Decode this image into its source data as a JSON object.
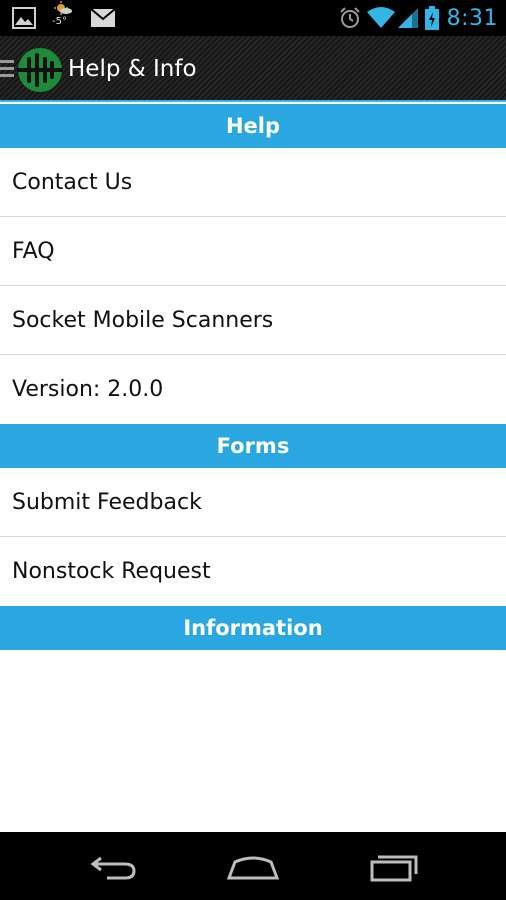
{
  "status_bar": {
    "weather_temp": "-5°",
    "time": "8:31",
    "icons": [
      "image-icon",
      "weather-icon",
      "gmail-icon",
      "alarm-icon",
      "wifi-icon",
      "signal-icon",
      "battery-charging-icon"
    ]
  },
  "action_bar": {
    "title": "Help & Info",
    "icons": [
      "drawer-menu-icon",
      "app-logo-icon"
    ]
  },
  "sections": [
    {
      "header": "Help",
      "items": [
        "Contact Us",
        "FAQ",
        "Socket Mobile Scanners",
        "Version: 2.0.0"
      ]
    },
    {
      "header": "Forms",
      "items": [
        "Submit Feedback",
        "Nonstock Request"
      ]
    },
    {
      "header": "Information",
      "items": []
    }
  ],
  "nav_bar": {
    "icons": [
      "back-icon",
      "home-icon",
      "recent-apps-icon"
    ]
  },
  "colors": {
    "accent": "#33b5e5",
    "section_header": "#2aa7e0",
    "logo_green": "#1e8b3a"
  }
}
